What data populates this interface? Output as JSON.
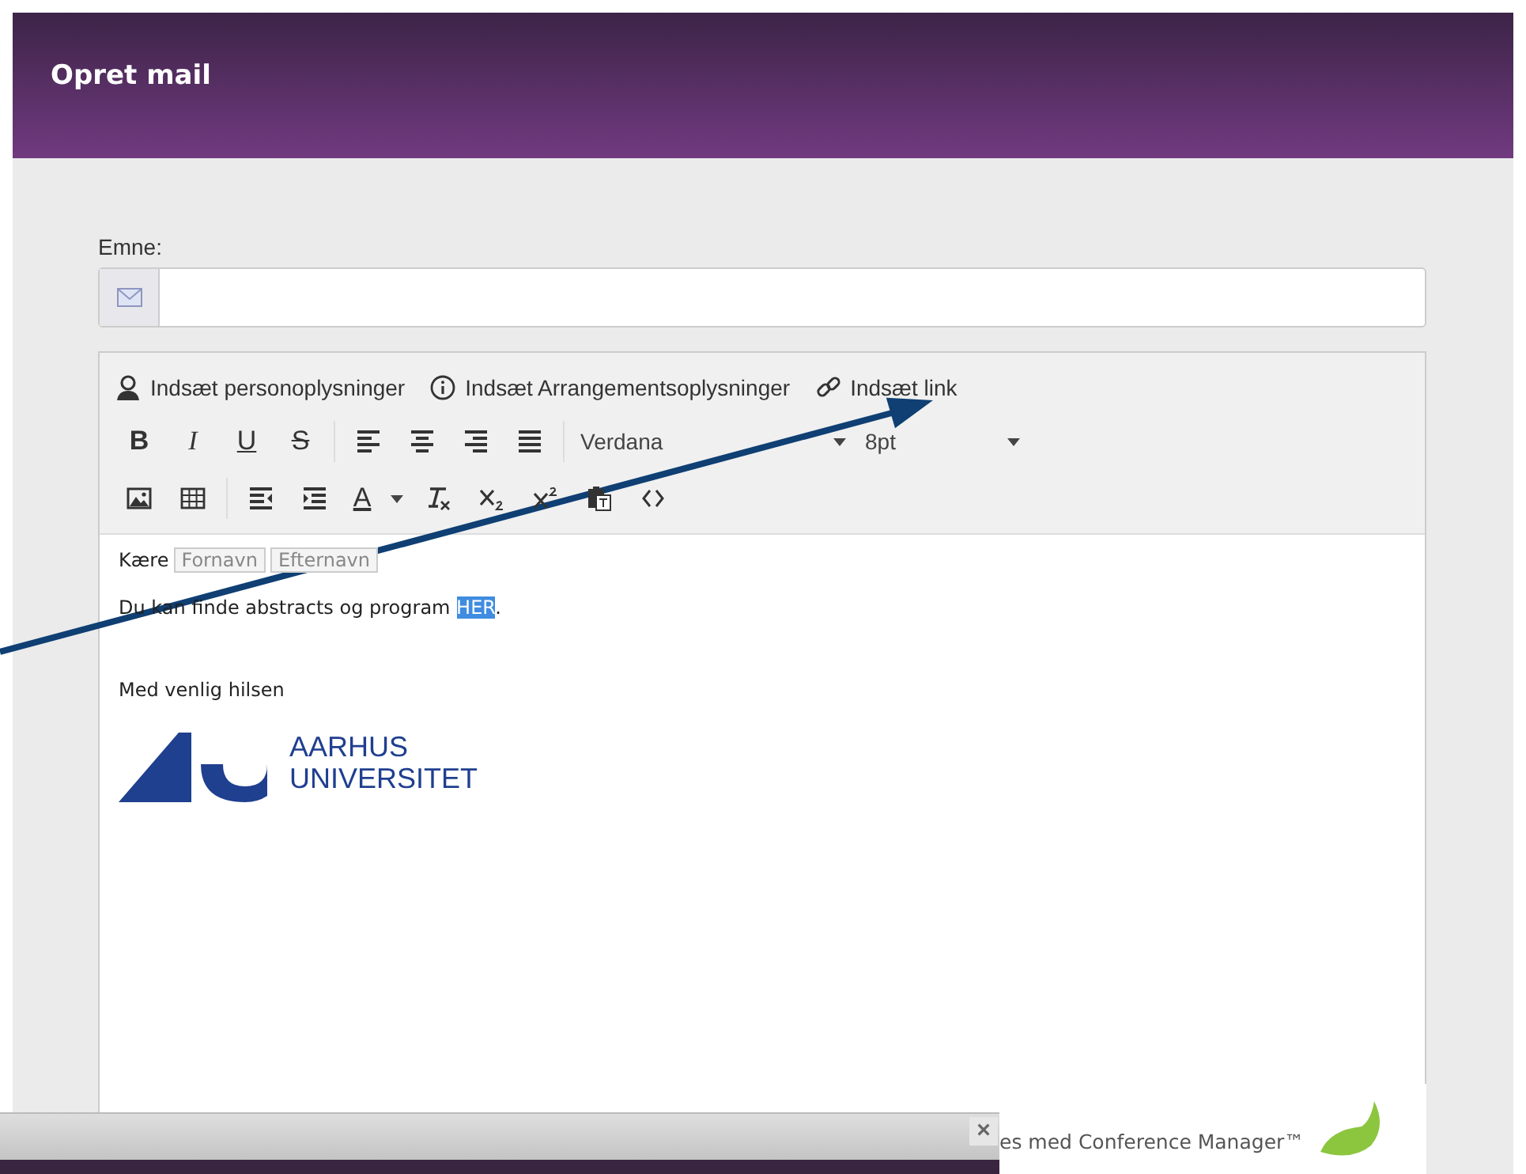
{
  "header": {
    "title": "Opret mail"
  },
  "subject": {
    "label": "Emne:"
  },
  "editor": {
    "insert_buttons": [
      {
        "kind": "person",
        "label": "Indsæt personoplysninger"
      },
      {
        "kind": "info",
        "label": "Indsæt Arrangementsoplysninger"
      },
      {
        "kind": "link",
        "label": "Indsæt link"
      }
    ],
    "format_row": [
      {
        "kind": "bold",
        "label": "B"
      },
      {
        "kind": "italic",
        "label": "I"
      },
      {
        "kind": "underline",
        "label": "U"
      },
      {
        "kind": "strike",
        "label": "S"
      },
      {
        "kind": "sep"
      },
      {
        "kind": "align-left"
      },
      {
        "kind": "align-center"
      },
      {
        "kind": "align-right"
      },
      {
        "kind": "justify"
      },
      {
        "kind": "sep"
      },
      {
        "kind": "font-select",
        "value": "Verdana"
      },
      {
        "kind": "size-select",
        "value": "8pt"
      }
    ],
    "insert_row": [
      {
        "kind": "image"
      },
      {
        "kind": "table"
      },
      {
        "kind": "sep"
      },
      {
        "kind": "outdent"
      },
      {
        "kind": "indent"
      },
      {
        "kind": "text-color",
        "label": "A"
      },
      {
        "kind": "clear-format"
      },
      {
        "kind": "subscript"
      },
      {
        "kind": "superscript"
      },
      {
        "kind": "paste-text"
      },
      {
        "kind": "code"
      }
    ],
    "content": {
      "greeting": "Kære",
      "tokens": [
        "Fornavn",
        "Efternavn"
      ],
      "paragraph": {
        "before": "Du kan finde abstracts og program ",
        "selection": "HER",
        "after": "."
      },
      "closing": "Med venlig hilsen",
      "logo": {
        "line1": "AARHUS",
        "line2": "UNIVERSITET"
      }
    }
  },
  "bottom_bar": {
    "close": "×"
  },
  "footer": {
    "text": "es med Conference Manager™"
  }
}
